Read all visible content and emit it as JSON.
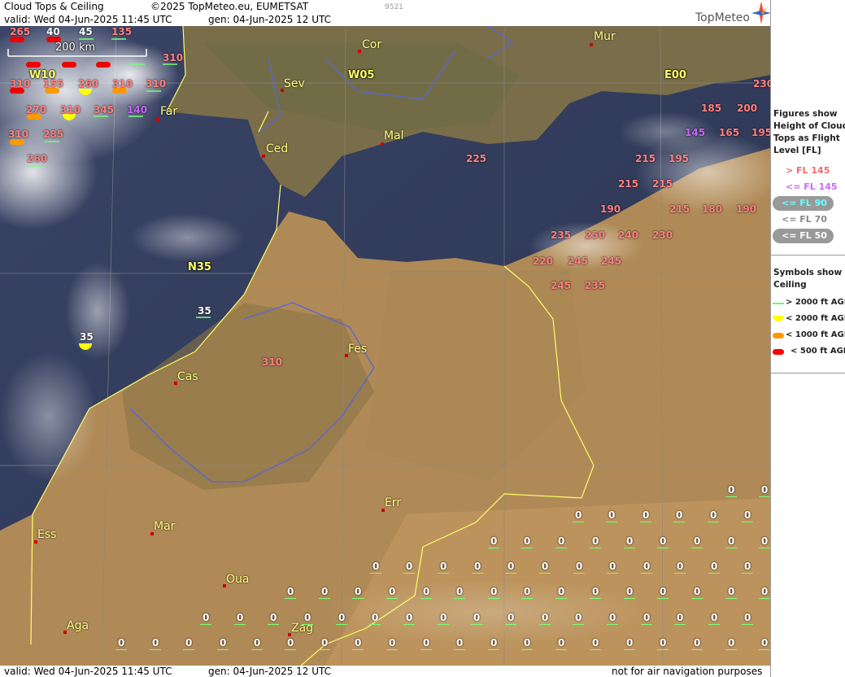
{
  "header": {
    "title": "Cloud Tops & Ceiling",
    "copyright": "©2025 TopMeteo.eu, EUMETSAT",
    "code": "9521",
    "valid": "valid:  Wed  04-Jun-2025  11:45 UTC",
    "gen": "gen: 04-Jun-2025 12 UTC",
    "brand": "TopMeteo"
  },
  "footer": {
    "valid": "valid:  Wed  04-Jun-2025  11:45 UTC",
    "gen": "gen: 04-Jun-2025 12 UTC",
    "note": "not for air navigation purposes"
  },
  "scale_label": "200 km",
  "grid_labels": [
    "W10",
    "W05",
    "E00",
    "N35"
  ],
  "cities": [
    "Cor",
    "Mur",
    "Sev",
    "Far",
    "Ced",
    "Mal",
    "Fes",
    "Cas",
    "Err",
    "Ess",
    "Mar",
    "Oua",
    "Aga",
    "Zag"
  ],
  "cloud_tops": [
    {
      "v": "265",
      "c": "#ff8080"
    },
    {
      "v": "40",
      "c": "#ffffff"
    },
    {
      "v": "45",
      "c": "#ffffff"
    },
    {
      "v": "135",
      "c": "#ff8080"
    },
    {
      "v": "310",
      "c": "#ff8080"
    },
    {
      "v": "310",
      "c": "#ff8080"
    },
    {
      "v": "155",
      "c": "#ff8080"
    },
    {
      "v": "260",
      "c": "#ff8080"
    },
    {
      "v": "310",
      "c": "#ff8080"
    },
    {
      "v": "310",
      "c": "#ff8080"
    },
    {
      "v": "270",
      "c": "#ff8080"
    },
    {
      "v": "310",
      "c": "#ff8080"
    },
    {
      "v": "345",
      "c": "#ff8080"
    },
    {
      "v": "140",
      "c": "#cc66ff"
    },
    {
      "v": "310",
      "c": "#ff8080"
    },
    {
      "v": "285",
      "c": "#ff8080"
    },
    {
      "v": "260",
      "c": "#ff8080"
    },
    {
      "v": "230",
      "c": "#ff8080"
    },
    {
      "v": "185",
      "c": "#ff8080"
    },
    {
      "v": "200",
      "c": "#ff8080"
    },
    {
      "v": "145",
      "c": "#cc66ff"
    },
    {
      "v": "165",
      "c": "#ff8080"
    },
    {
      "v": "195",
      "c": "#ff8080"
    },
    {
      "v": "225",
      "c": "#ff8080"
    },
    {
      "v": "215",
      "c": "#ff8080"
    },
    {
      "v": "195",
      "c": "#ff8080"
    },
    {
      "v": "215",
      "c": "#ff8080"
    },
    {
      "v": "215",
      "c": "#ff8080"
    },
    {
      "v": "190",
      "c": "#ff8080"
    },
    {
      "v": "215",
      "c": "#ff8080"
    },
    {
      "v": "180",
      "c": "#ff8080"
    },
    {
      "v": "190",
      "c": "#ff8080"
    },
    {
      "v": "235",
      "c": "#ff8080"
    },
    {
      "v": "250",
      "c": "#ff8080"
    },
    {
      "v": "240",
      "c": "#ff8080"
    },
    {
      "v": "230",
      "c": "#ff8080"
    },
    {
      "v": "220",
      "c": "#ff8080"
    },
    {
      "v": "245",
      "c": "#ff8080"
    },
    {
      "v": "245",
      "c": "#ff8080"
    },
    {
      "v": "245",
      "c": "#ff8080"
    },
    {
      "v": "235",
      "c": "#ff8080"
    },
    {
      "v": "35",
      "c": "#ffffff"
    },
    {
      "v": "35",
      "c": "#ffffff"
    },
    {
      "v": "310",
      "c": "#ff8080"
    }
  ],
  "zero_label": "0",
  "legend": {
    "figures_title": [
      "Figures show",
      "Height of Cloud",
      "Tops as Flight",
      "Level  [FL]"
    ],
    "fl_items": [
      {
        "text": "> FL 145",
        "color": "#ff6666",
        "pill": false
      },
      {
        "text": "<= FL 145",
        "color": "#cc66ff",
        "pill": false
      },
      {
        "text": "<= FL 90",
        "color": "#66ffff",
        "pill": true
      },
      {
        "text": "<= FL 70",
        "color": "#888888",
        "pill": false
      },
      {
        "text": "<= FL 50",
        "color": "#ffffff",
        "pill": true
      }
    ],
    "symbols_title": [
      "Symbols show",
      "Ceiling"
    ],
    "symbol_items": [
      {
        "text": "> 2000 ft AGL",
        "color": "#66ff66",
        "shape": "line"
      },
      {
        "text": "< 2000 ft AGL",
        "color": "#ffff00",
        "shape": "half"
      },
      {
        "text": "< 1000 ft AGL",
        "color": "#ff9900",
        "shape": "pill"
      },
      {
        "text": "< 500 ft AGL",
        "color": "#ff0000",
        "shape": "pill"
      }
    ]
  }
}
